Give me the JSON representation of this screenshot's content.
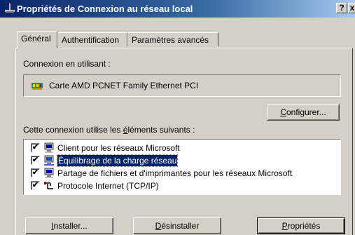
{
  "window": {
    "title": "Propriétés de Connexion au réseau local",
    "help_label": "?",
    "close_label": "x"
  },
  "tabs": [
    {
      "label": "Général"
    },
    {
      "label": "Authentification"
    },
    {
      "label": "Paramètres avancés"
    }
  ],
  "connection": {
    "using_label": "Connexion en utilisant :",
    "adapter_name": "Carte AMD PCNET Family Ethernet PCI",
    "configure_pre": "",
    "configure_access": "C",
    "configure_post": "onfigurer..."
  },
  "components": {
    "header_pre": "Cette connexion utilise les ",
    "header_access": "é",
    "header_post": "léments suivants :",
    "items": [
      {
        "label": "Client pour les réseaux Microsoft",
        "checked": true,
        "icon": "network-client-icon"
      },
      {
        "label": "Équilibrage de la charge réseau",
        "checked": true,
        "icon": "network-load-balancing-icon",
        "selected": true
      },
      {
        "label": "Partage de fichiers et d'imprimantes pour les réseaux Microsoft",
        "checked": true,
        "icon": "file-printer-sharing-icon"
      },
      {
        "label": "Protocole Internet (TCP/IP)",
        "checked": true,
        "icon": "tcp-ip-protocol-icon"
      }
    ],
    "check_mark": "✔"
  },
  "buttons": {
    "install_access": "I",
    "install_post": "nstaller...",
    "uninstall_access": "D",
    "uninstall_post": "ésinstaller",
    "properties_access": "P",
    "properties_post": "ropriétés"
  },
  "colors": {
    "titlebar_start": "#0a246a",
    "titlebar_end": "#a6caf0",
    "face": "#d4d0c8",
    "selection": "#0a246a"
  }
}
